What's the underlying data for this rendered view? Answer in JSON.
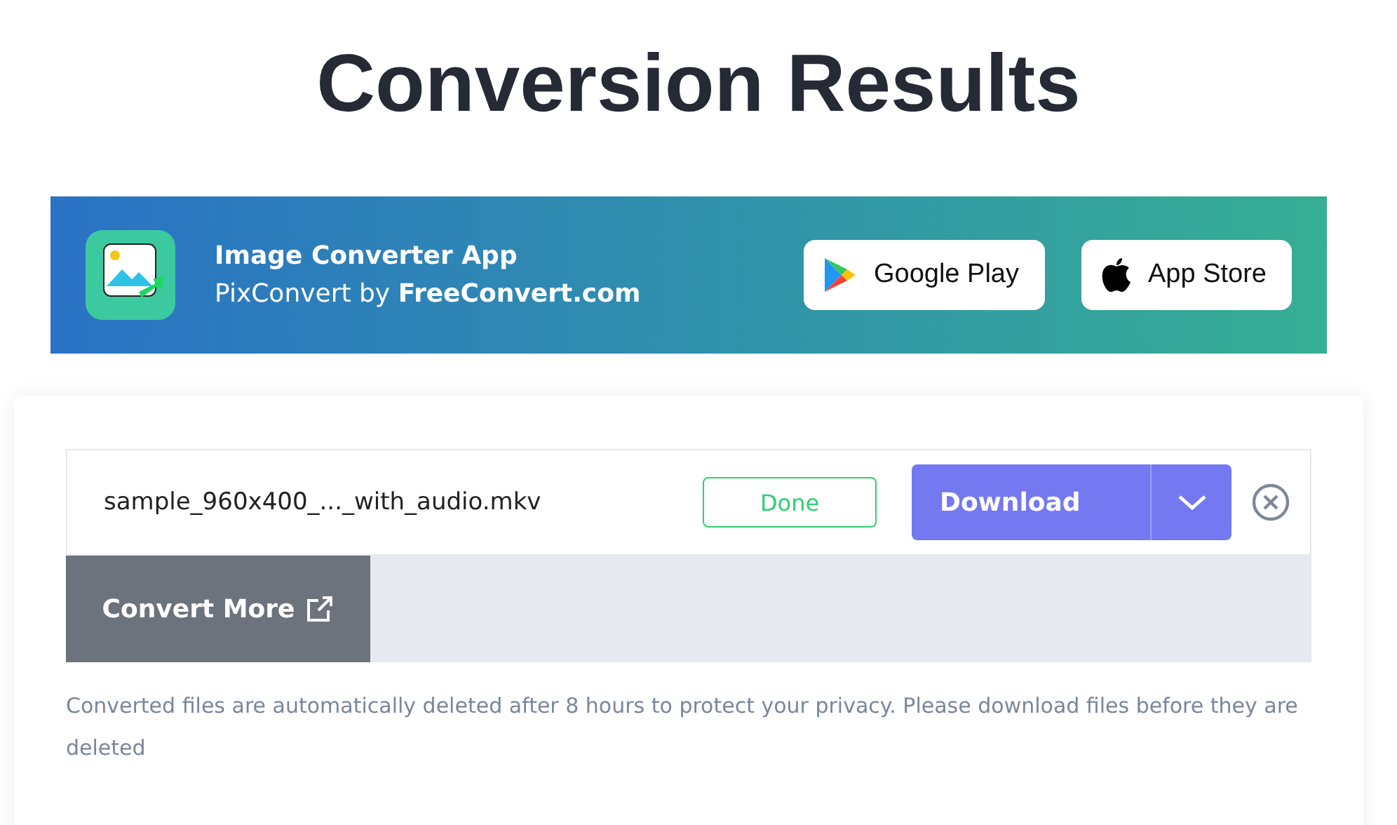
{
  "title": "Conversion Results",
  "banner": {
    "app_name": "Image Converter App",
    "byline": "PixConvert by **FreeConvert.com**",
    "stores": [
      {
        "kind": "google",
        "label": "Google Play"
      },
      {
        "kind": "apple",
        "label": "App Store"
      }
    ]
  },
  "file": {
    "name": "sample_960x400_..._with_audio.mkv",
    "status": {
      "kind": "done",
      "label": "Done"
    },
    "download": "Download"
  },
  "convert_more": "Convert More",
  "note": "Converted files are automatically deleted after 8 hours to protect your privacy. Please download files before they are deleted"
}
